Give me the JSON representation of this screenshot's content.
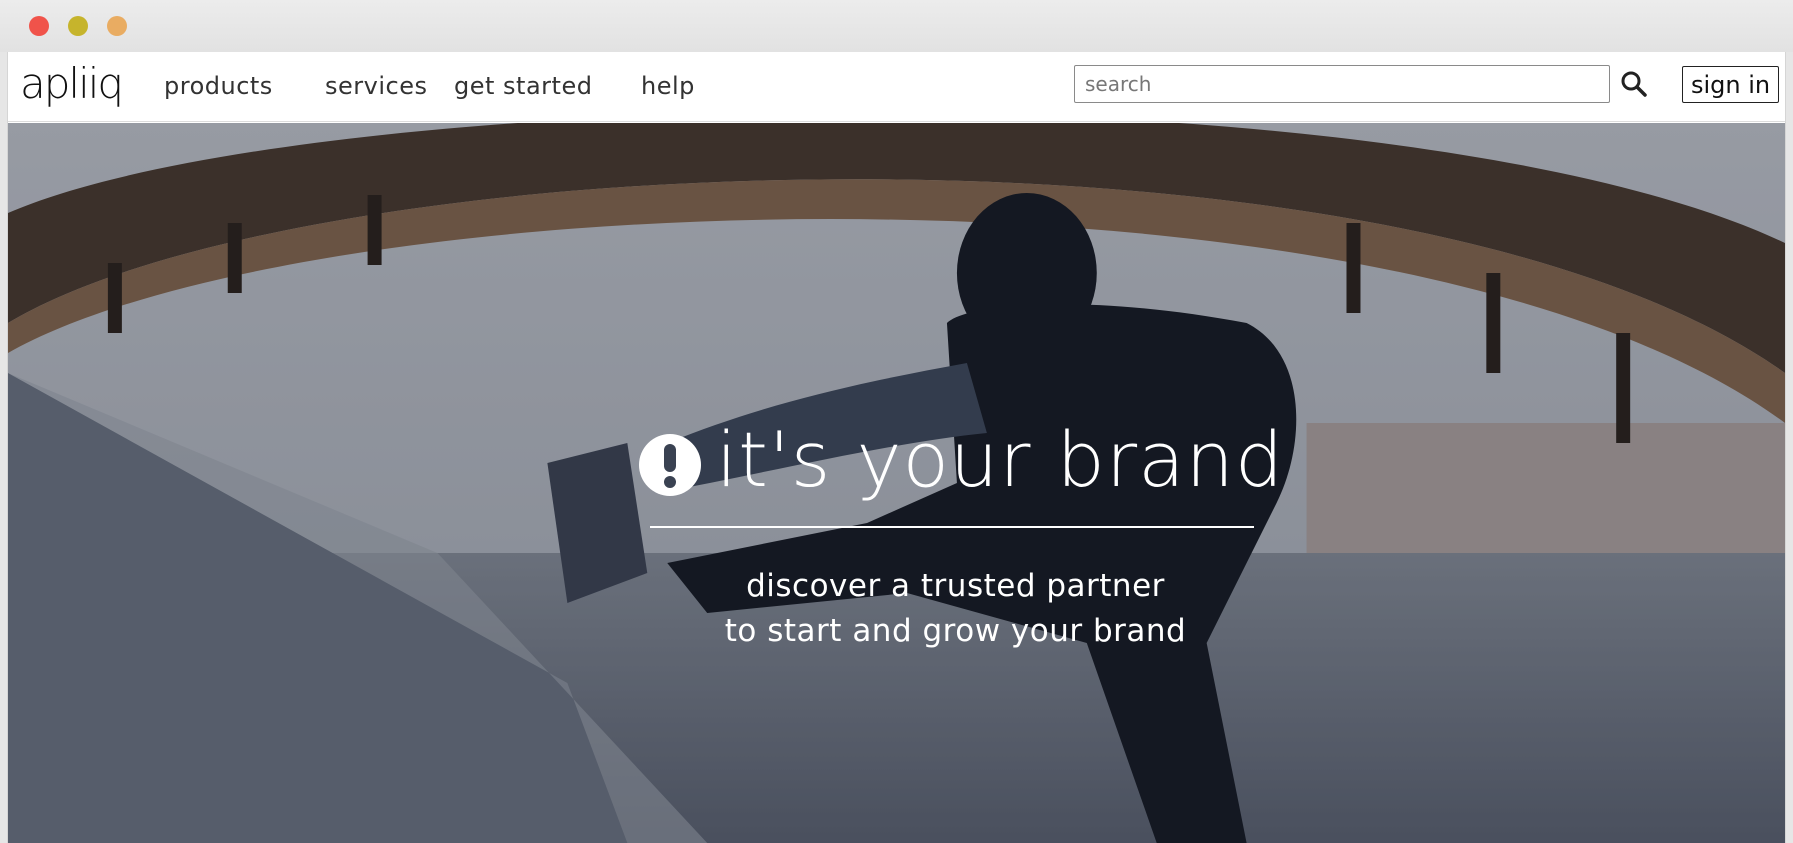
{
  "window": {
    "controls": [
      "close",
      "minimize",
      "maximize"
    ],
    "colors": {
      "close": "#f0534a",
      "minimize": "#c6b42c",
      "maximize": "#e9ac62"
    }
  },
  "navbar": {
    "logo_text": "apliiq",
    "links": [
      {
        "label": "products"
      },
      {
        "label": "services"
      },
      {
        "label": "get started"
      },
      {
        "label": "help"
      }
    ],
    "search": {
      "placeholder": "search",
      "value": "",
      "icon": "search-icon"
    },
    "signin_label": "sign in"
  },
  "hero": {
    "icon": "exclamation-circle-icon",
    "headline": "it's your brand",
    "sub_line_1": "discover a trusted partner",
    "sub_line_2": "to start and grow your brand"
  },
  "colors": {
    "nav_text": "#333333",
    "hero_text": "#ffffff",
    "hero_overlay": "rgba(20,25,40,0.28)"
  }
}
